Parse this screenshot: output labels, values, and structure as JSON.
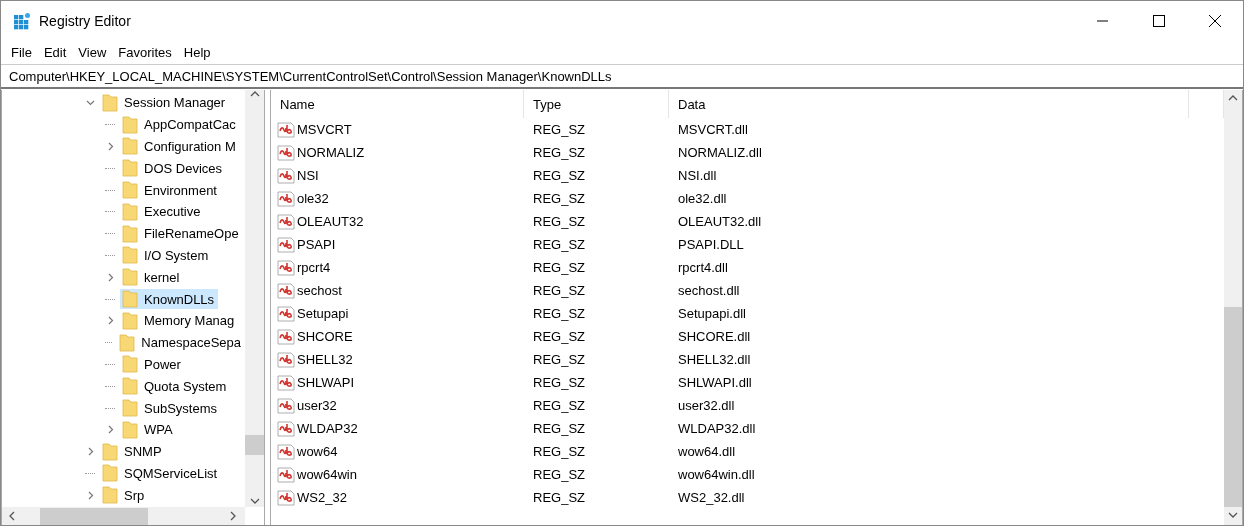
{
  "window": {
    "title": "Registry Editor"
  },
  "menu": [
    "File",
    "Edit",
    "View",
    "Favorites",
    "Help"
  ],
  "address": "Computer\\HKEY_LOCAL_MACHINE\\SYSTEM\\CurrentControlSet\\Control\\Session Manager\\KnownDLLs",
  "tree": [
    {
      "label": "Session Manager",
      "expanded": true,
      "selected": false,
      "children": [
        {
          "label": "AppCompatCac",
          "selected": false
        },
        {
          "label": "Configuration M",
          "expanded": false,
          "selected": false
        },
        {
          "label": "DOS Devices",
          "selected": false
        },
        {
          "label": "Environment",
          "selected": false
        },
        {
          "label": "Executive",
          "selected": false
        },
        {
          "label": "FileRenameOpe",
          "selected": false
        },
        {
          "label": "I/O System",
          "selected": false
        },
        {
          "label": "kernel",
          "expanded": false,
          "selected": false
        },
        {
          "label": "KnownDLLs",
          "selected": true
        },
        {
          "label": "Memory Manag",
          "expanded": false,
          "selected": false
        },
        {
          "label": "NamespaceSepa",
          "selected": false
        },
        {
          "label": "Power",
          "selected": false
        },
        {
          "label": "Quota System",
          "selected": false
        },
        {
          "label": "SubSystems",
          "selected": false
        },
        {
          "label": "WPA",
          "expanded": false,
          "selected": false
        }
      ]
    },
    {
      "label": "SNMP",
      "expanded": false,
      "selected": false
    },
    {
      "label": "SQMServiceList",
      "selected": false
    },
    {
      "label": "Srp",
      "expanded": false,
      "selected": false
    }
  ],
  "table": {
    "columns": [
      "Name",
      "Type",
      "Data"
    ],
    "rows": [
      [
        "MSVCRT",
        "REG_SZ",
        "MSVCRT.dll"
      ],
      [
        "NORMALIZ",
        "REG_SZ",
        "NORMALIZ.dll"
      ],
      [
        "NSI",
        "REG_SZ",
        "NSI.dll"
      ],
      [
        "ole32",
        "REG_SZ",
        "ole32.dll"
      ],
      [
        "OLEAUT32",
        "REG_SZ",
        "OLEAUT32.dll"
      ],
      [
        "PSAPI",
        "REG_SZ",
        "PSAPI.DLL"
      ],
      [
        "rpcrt4",
        "REG_SZ",
        "rpcrt4.dll"
      ],
      [
        "sechost",
        "REG_SZ",
        "sechost.dll"
      ],
      [
        "Setupapi",
        "REG_SZ",
        "Setupapi.dll"
      ],
      [
        "SHCORE",
        "REG_SZ",
        "SHCORE.dll"
      ],
      [
        "SHELL32",
        "REG_SZ",
        "SHELL32.dll"
      ],
      [
        "SHLWAPI",
        "REG_SZ",
        "SHLWAPI.dll"
      ],
      [
        "user32",
        "REG_SZ",
        "user32.dll"
      ],
      [
        "WLDAP32",
        "REG_SZ",
        "WLDAP32.dll"
      ],
      [
        "wow64",
        "REG_SZ",
        "wow64.dll"
      ],
      [
        "wow64win",
        "REG_SZ",
        "wow64win.dll"
      ],
      [
        "WS2_32",
        "REG_SZ",
        "WS2_32.dll"
      ]
    ]
  }
}
